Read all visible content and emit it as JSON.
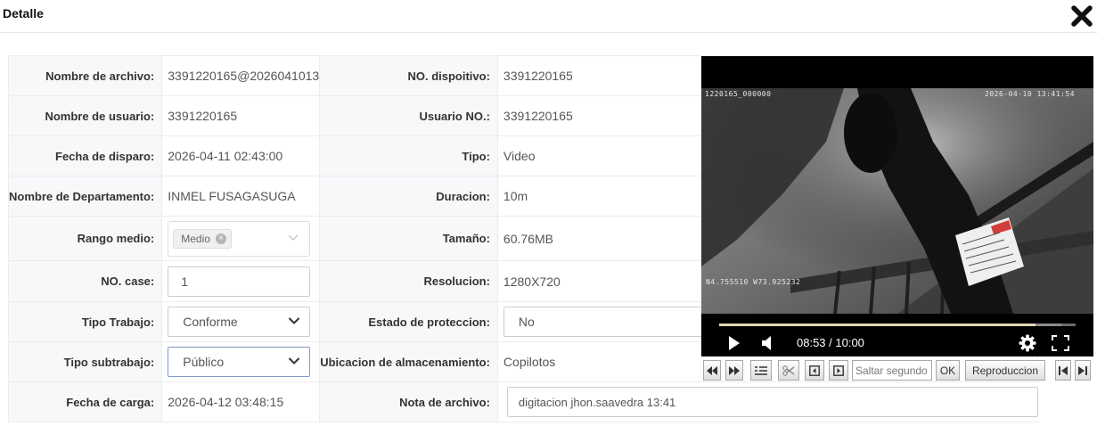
{
  "header": {
    "title": "Detalle",
    "close_icon": "close-icon"
  },
  "fields": {
    "nombre_archivo": {
      "label": "Nombre de archivo:",
      "value": "3391220165@2026041013"
    },
    "no_dispositivo": {
      "label": "NO. dispoitivo:",
      "value": "3391220165"
    },
    "nombre_usuario": {
      "label": "Nombre de usuario:",
      "value": "3391220165"
    },
    "usuario_no": {
      "label": "Usuario NO.:",
      "value": "3391220165"
    },
    "fecha_disparo": {
      "label": "Fecha de disparo:",
      "value": "2026-04-11 02:43:00"
    },
    "tipo": {
      "label": "Tipo:",
      "value": "Video"
    },
    "departamento": {
      "label": "Nombre de Departamento:",
      "value": "INMEL FUSAGASUGA"
    },
    "duracion": {
      "label": "Duracion:",
      "value": "10m"
    },
    "rango_medio": {
      "label": "Rango medio:",
      "tag": "Medio"
    },
    "tamano": {
      "label": "Tamaño:",
      "value": "60.76MB"
    },
    "no_case": {
      "label": "NO. case:",
      "value": "1"
    },
    "resolucion": {
      "label": "Resolucion:",
      "value": "1280X720"
    },
    "tipo_trabajo": {
      "label": "Tipo Trabajo:",
      "value": "Conforme"
    },
    "estado_proteccion": {
      "label": "Estado de proteccion:",
      "value": "No"
    },
    "tipo_subtrabajo": {
      "label": "Tipo subtrabajo:",
      "value": "Público"
    },
    "ubicacion": {
      "label": "Ubicacion de almacenamiento:",
      "value": "Copilotos"
    },
    "fecha_carga": {
      "label": "Fecha de carga:",
      "value": "2026-04-12 03:48:15"
    },
    "nota_archivo": {
      "label": "Nota de archivo:",
      "value": "digitacion jhon.saavedra 13:41"
    }
  },
  "player": {
    "osd_top_left": "1220165_000000",
    "osd_top_right": "2026-04-10  13:41:54",
    "osd_bottom_left": "N4.755510  W73.925232",
    "time_display": "08:53 / 10:00",
    "progress_fraction": 0.888,
    "buffer_fraction": 0.96
  },
  "toolbar": {
    "seek_placeholder": "Saltar segundo",
    "ok_label": "OK",
    "playback_label": "Reproduccion"
  },
  "colors": {
    "label_bg": "#f7f8fa",
    "border": "#ececec",
    "progress": "#e2d7b6"
  }
}
